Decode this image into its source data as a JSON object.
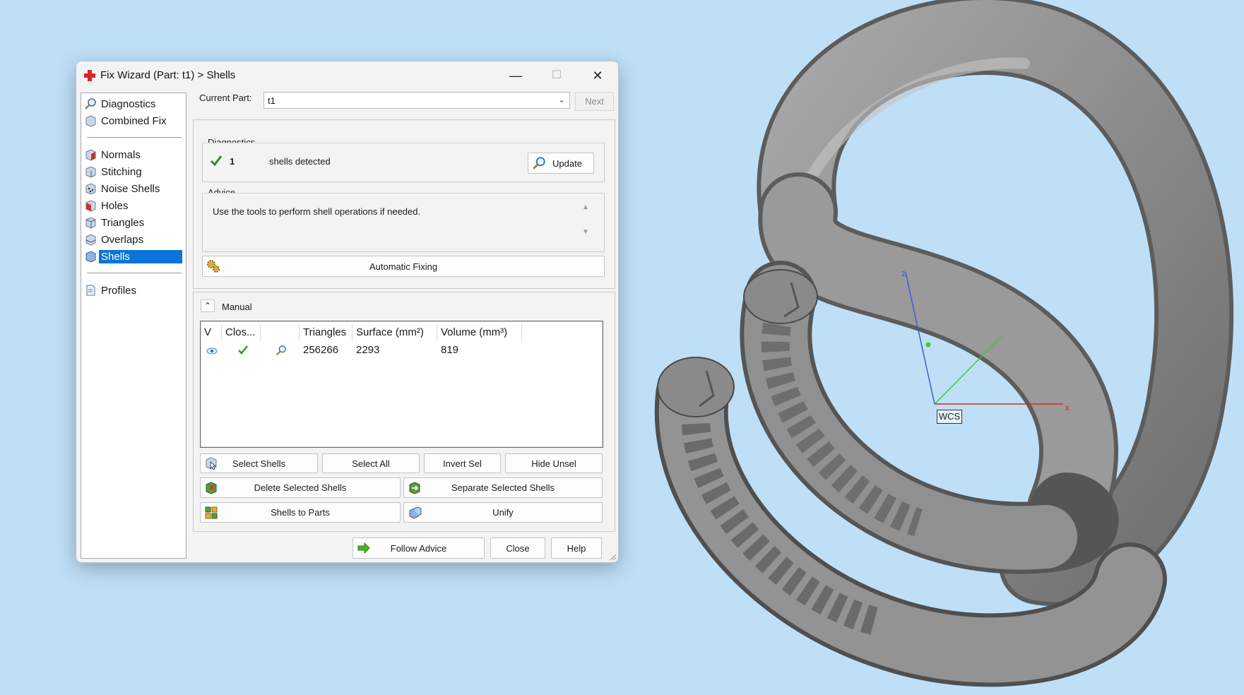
{
  "window": {
    "title": "Fix Wizard (Part: t1) > Shells",
    "minimize": "—",
    "maximize": "☐",
    "close": "✕"
  },
  "nav": {
    "items": [
      {
        "label": "Diagnostics",
        "icon": "magnifier-icon"
      },
      {
        "label": "Combined Fix",
        "icon": "cube-icon"
      },
      {
        "label": "Normals",
        "icon": "normals-cube-icon"
      },
      {
        "label": "Stitching",
        "icon": "stitching-cube-icon"
      },
      {
        "label": "Noise Shells",
        "icon": "noise-cube-icon"
      },
      {
        "label": "Holes",
        "icon": "holes-cube-icon"
      },
      {
        "label": "Triangles",
        "icon": "triangles-cube-icon"
      },
      {
        "label": "Overlaps",
        "icon": "overlaps-cube-icon"
      },
      {
        "label": "Shells",
        "icon": "shells-cube-icon",
        "selected": true
      },
      {
        "label": "Profiles",
        "icon": "document-icon"
      }
    ]
  },
  "current_part": {
    "label": "Current Part:",
    "value": "t1",
    "next_label": "Next"
  },
  "diagnostics": {
    "title": "Diagnostics",
    "count": "1",
    "status_text": "shells detected",
    "update_label": "Update"
  },
  "advice": {
    "title": "Advice",
    "text": "Use the tools to perform shell operations if needed."
  },
  "auto_fix_label": "Automatic Fixing",
  "manual": {
    "title": "Manual",
    "collapse_glyph": "⌃",
    "columns": [
      "V",
      "Clos...",
      "",
      "Triangles",
      "Surface (mm²)",
      "Volume (mm³)"
    ],
    "rows": [
      {
        "triangles": "256266",
        "surface": "2293",
        "volume": "819"
      }
    ],
    "buttons": {
      "select_shells": "Select Shells",
      "select_all": "Select All",
      "invert_sel": "Invert Sel",
      "hide_unsel": "Hide Unsel",
      "delete_selected": "Delete Selected Shells",
      "separate_selected": "Separate Selected Shells",
      "shells_to_parts": "Shells to Parts",
      "unify": "Unify"
    }
  },
  "footer": {
    "follow_advice": "Follow Advice",
    "close": "Close",
    "help": "Help"
  },
  "viewport": {
    "wcs_label": "WCS",
    "axis_x": "x",
    "axis_z": "z"
  },
  "colors": {
    "background": "#bfdff7",
    "selection": "#0a74d8",
    "model_gray": "#8f8f8f",
    "axis_x": "#d42a2a",
    "axis_y": "#3ccc2e",
    "axis_z": "#3a5fcc"
  }
}
